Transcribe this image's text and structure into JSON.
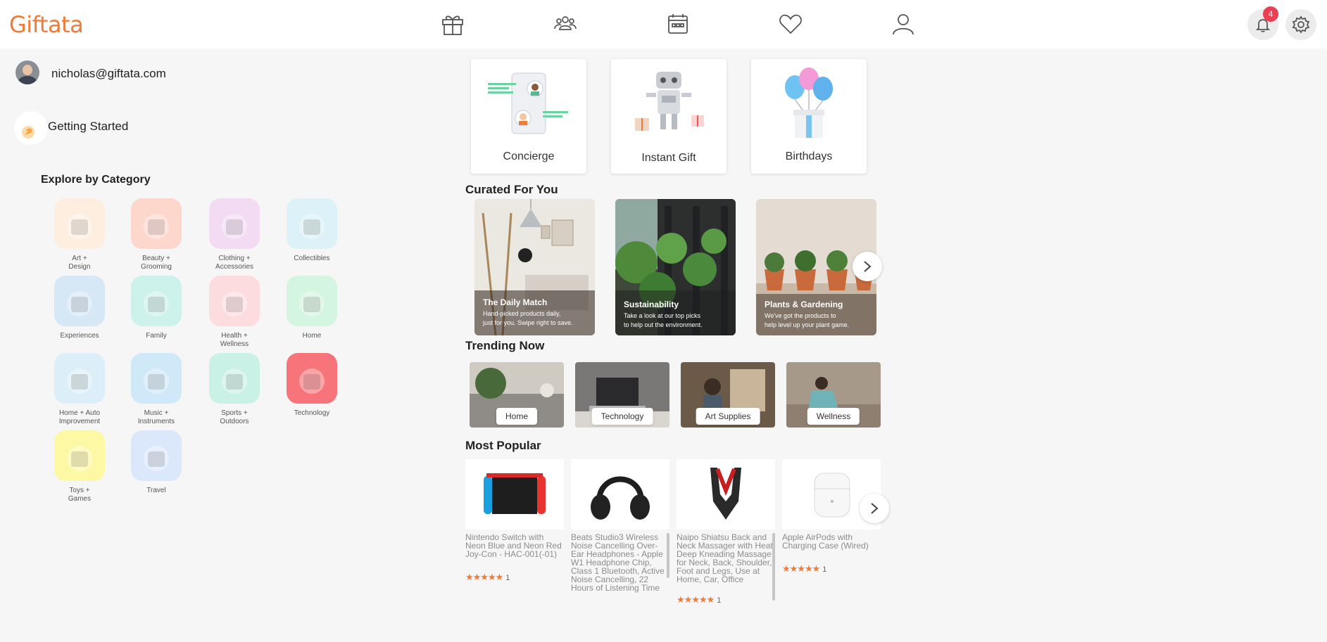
{
  "brand": {
    "logo": "Giftata",
    "accent": "#ef7b3a"
  },
  "nav": {
    "items": [
      {
        "name": "gifts-nav",
        "icon": "gift-icon"
      },
      {
        "name": "groups-nav",
        "icon": "people-icon"
      },
      {
        "name": "calendar-nav",
        "icon": "calendar-icon"
      },
      {
        "name": "wishlist-nav",
        "icon": "heart-icon"
      },
      {
        "name": "profile-nav",
        "icon": "user-icon"
      }
    ],
    "notifications": {
      "count": "4",
      "icon": "bell-icon"
    },
    "settings_icon": "gear-icon"
  },
  "sidebar": {
    "user_email": "nicholas@giftata.com",
    "getting_started": "Getting Started",
    "explore_title": "Explore by Category",
    "categories": [
      {
        "label": "Art +\nDesign",
        "bg": "#fdeee0"
      },
      {
        "label": "Beauty +\nGrooming",
        "bg": "#fdd6cc"
      },
      {
        "label": "Clothing +\nAccessories",
        "bg": "#f3dcf3"
      },
      {
        "label": "Collectibles",
        "bg": "#dcf1f8"
      },
      {
        "label": "Experiences",
        "bg": "#d6e7f6"
      },
      {
        "label": "Family",
        "bg": "#cdf2ec"
      },
      {
        "label": "Health +\nWellness",
        "bg": "#fddce0"
      },
      {
        "label": "Home",
        "bg": "#d4f5df"
      },
      {
        "label": "Home + Auto\nImprovement",
        "bg": "#dceef8"
      },
      {
        "label": "Music +\nInstruments",
        "bg": "#cfe9f9"
      },
      {
        "label": "Sports +\nOutdoors",
        "bg": "#c9f1e6"
      },
      {
        "label": "Technology",
        "bg": "#f7757a"
      },
      {
        "label": "Toys +\nGames",
        "bg": "#fdf8a3"
      },
      {
        "label": "Travel",
        "bg": "#dbe8fb"
      }
    ]
  },
  "features": [
    {
      "label": "Concierge",
      "icon": "concierge-illustration"
    },
    {
      "label": "Instant Gift",
      "icon": "robot-illustration"
    },
    {
      "label": "Birthdays",
      "icon": "balloons-illustration"
    }
  ],
  "curated": {
    "title": "Curated For You",
    "items": [
      {
        "title": "The Daily Match",
        "desc": "Hand-picked products daily,\njust for you. Swipe right to save."
      },
      {
        "title": "Sustainability",
        "desc": "Take a look at our top picks\nto help out the environment."
      },
      {
        "title": "Plants & Gardening",
        "desc": "We've got the products to\nhelp level up your plant game."
      }
    ]
  },
  "trending": {
    "title": "Trending Now",
    "items": [
      "Home",
      "Technology",
      "Art Supplies",
      "Wellness"
    ]
  },
  "popular": {
    "title": "Most Popular",
    "items": [
      {
        "name": "Nintendo Switch with Neon Blue and Neon Red Joy-Con - HAC-001(-01)",
        "rating_count": "1",
        "stars": "★★★★★"
      },
      {
        "name": "Beats Studio3 Wireless Noise Cancelling Over-Ear Headphones - Apple W1 Headphone Chip, Class 1 Bluetooth, Active Noise Cancelling, 22 Hours of Listening Time",
        "rating_count": "",
        "stars": ""
      },
      {
        "name": "Naipo Shiatsu Back and Neck Massager with Heat Deep Kneading Massage for Neck, Back, Shoulder, Foot and Legs, Use at Home, Car, Office",
        "rating_count": "1",
        "stars": "★★★★★"
      },
      {
        "name": "Apple AirPods with Charging Case (Wired)",
        "rating_count": "1",
        "stars": "★★★★★"
      }
    ]
  }
}
